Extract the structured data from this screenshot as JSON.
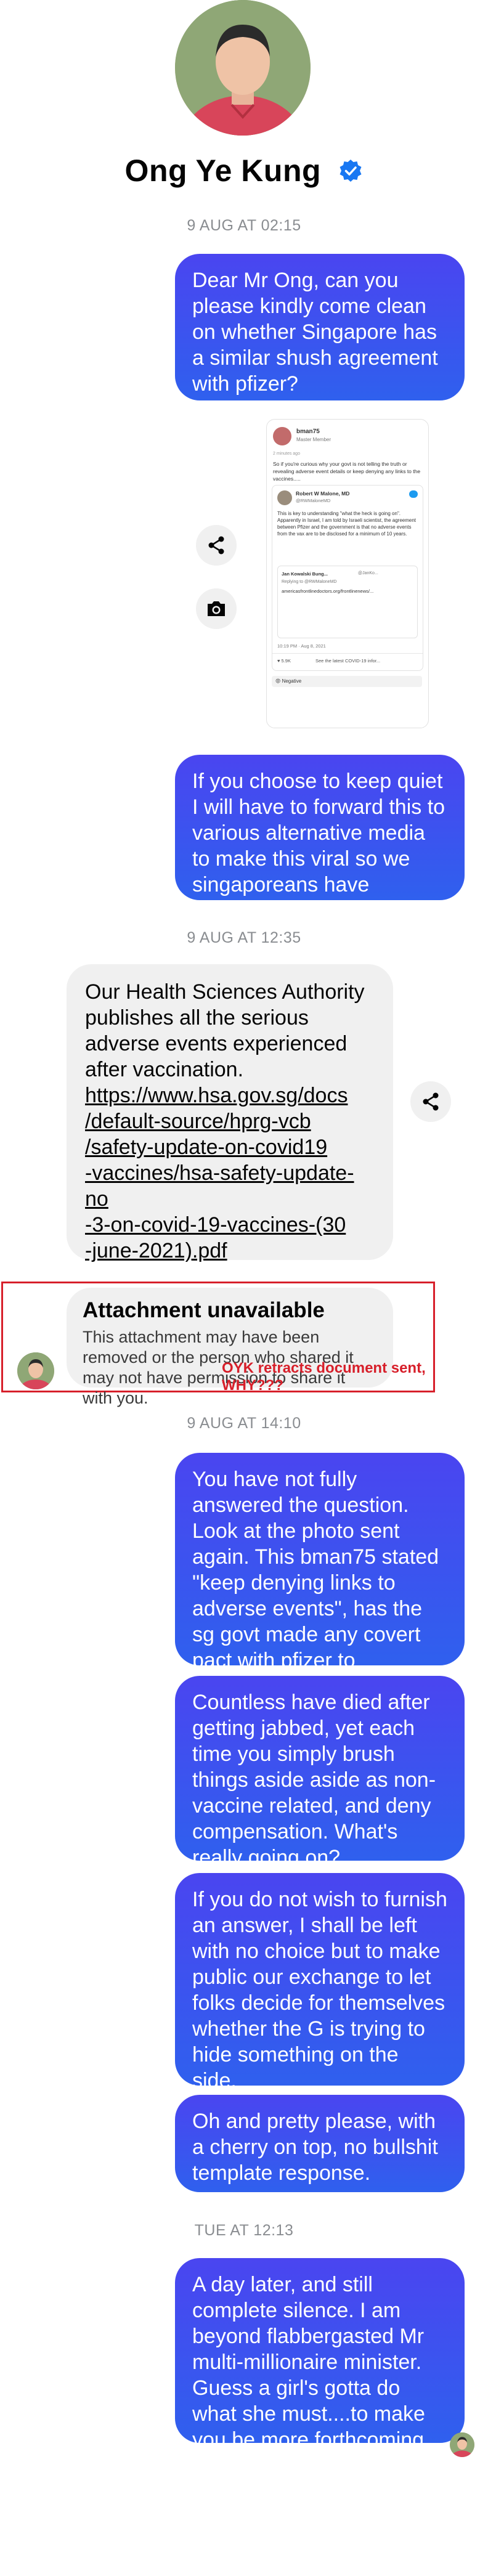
{
  "contact": {
    "name": "Ong Ye Kung",
    "verified_icon": "verified-badge-icon"
  },
  "timestamps": [
    "9 AUG AT 02:15",
    "9 AUG AT 12:35",
    "9 AUG AT 14:10",
    "TUE AT 12:13"
  ],
  "messages_1": [
    "Dear Mr Ong, can you please kindly come clean on whether Singapore has a similar shush agreement with pfizer?"
  ],
  "screenshot": {
    "user": "bman75",
    "role": "Master Member",
    "time": "2 minutes ago",
    "post": "So if you're curious why your govt is not telling the truth or revealing adverse event details or keep denying any links to the vaccines.....",
    "tweet_author": "Robert W Malone, MD",
    "tweet_handle": "@RWMaloneMD",
    "tweet_text": "This is key to understanding \"what the heck is going on\". Apparently in Israel, I am told by Israeli scientist, the agreement between Pfizer and the government is that no adverse events from the vax are to be disclosed for a minimum of 10 years.",
    "quoted_author": "Jan Kowalski Bung...",
    "quoted_handle": "@JanKo...",
    "replying": "Replying to @RWMaloneMD",
    "quoted_link": "americasfrontlinedoctors.org/frontlinenews/...",
    "tweet_time": "10:19 PM · Aug 8, 2021",
    "likes": "5.9K",
    "see_latest": "See the latest COVID-19 infor...",
    "reaction": "Negative"
  },
  "messages_2": [
    "If you choose to keep quiet I will have to forward this to various alternative media to make this viral so we singaporeans have answers"
  ],
  "incoming": {
    "text": "Our Health Sciences Authority publishes all the serious adverse events experienced after vaccination.",
    "link": "https://www.hsa.gov.sg/docs/default-source/hprg-vcb/safety-update-on-covid19-vaccines/hsa-safety-update-no-3-on-covid-19-vaccines-(30-june-2021).pdf",
    "link_lines": [
      "https://www.hsa.gov.sg/docs",
      "/default-source/hprg-vcb",
      "/safety-update-on-covid19",
      "-vaccines/hsa-safety-update-no",
      "-3-on-covid-19-vaccines-(30",
      "-june-2021).pdf"
    ],
    "attachment_title": "Attachment unavailable",
    "attachment_body": "This attachment may have been removed or the person who shared it may not have permission to share it with you.",
    "annotation": "OYK retracts document sent, WHY???"
  },
  "messages_3": [
    "You have not fully answered the question. Look at the photo sent again. This bman75 stated \"keep denying links to adverse events\", has the sg govt made any covert pact with pfizer to whitewash affairs?",
    "Countless have died after getting jabbed, yet each time you simply brush things aside aside as non-vaccine related, and deny compensation. What's really going on?",
    "If you do not wish to furnish an answer, I shall be left with no choice but to make public our exchange to let folks decide for themselves whether the G is trying to hide something on the side.",
    "Oh and pretty please, with a cherry on top, no bullshit template response."
  ],
  "messages_4": [
    "A day later, and still complete silence. I am beyond flabbergasted Mr multi-millionaire minister. Guess a girl's gotta do what she must....to make you be more forthcoming."
  ],
  "colors": {
    "bubble_top": "#4a45f0",
    "bubble_bottom": "#2f60ee",
    "incoming_bg": "#f0f0f0",
    "timestamp": "#8a8d91",
    "annotation_red": "#d71f2a",
    "verified": "#1877f2"
  },
  "icons": [
    "share-icon",
    "camera-icon",
    "verified-badge-icon"
  ]
}
